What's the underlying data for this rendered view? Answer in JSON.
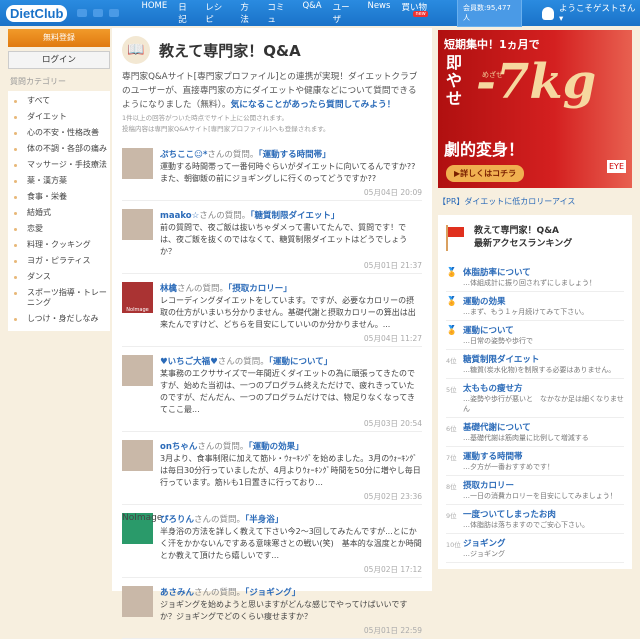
{
  "header": {
    "logo": "DietClub",
    "nav": [
      "HOME",
      "日記",
      "レシピ",
      "方法",
      "コミュ",
      "Q&A",
      "ユーザ",
      "News",
      "買い物"
    ],
    "new_badge": "new",
    "members": "会員数:95,477人",
    "guest": "ようこそゲストさん ▾"
  },
  "left": {
    "register": "無料登録",
    "login": "ログイン",
    "category_label": "質問カテゴリー",
    "categories": [
      "すべて",
      "ダイエット",
      "心の不安・性格改善",
      "体の不調・各部の痛み",
      "マッサージ・手技療法",
      "薬・漢方薬",
      "食事・栄養",
      "結婚式",
      "恋愛",
      "料理・クッキング",
      "ヨガ・ピラティス",
      "ダンス",
      "スポーツ指導・トレーニング",
      "しつけ・身だしなみ"
    ]
  },
  "main": {
    "title": "教えて専門家！Q&A",
    "desc": "専門家Q&Aサイト[専門家プロファイル]との連携が実現！ダイエットクラブのユーザーが、直接専門家の方にダイエットや健康などについて質問できるようになりました（無料）。",
    "desc_link": "気になることがあったら質問してみよう！",
    "note1": "1件以上の回答がついた時点でサイト上に公開されます。",
    "note2": "投稿内容は専門家Q&Aサイト[専門家プロファイル]へも登録されます。",
    "suffix": "さんの質問。",
    "questions": [
      {
        "user": "ぷちここ☺*",
        "topic": "「運動する時間帯」",
        "text": "運動する時間帯って一番何時ぐらいがダイエットに向いてるんですか??また、朝御飯の前にジョギングしに行くのってどうですか??",
        "date": "05月04日 20:09",
        "img": "photo"
      },
      {
        "user": "maako☆",
        "topic": "「糖質制限ダイエット」",
        "text": "前の質問で、夜ご飯は抜いちゃダメって書いてたんで、質問です！では、夜ご飯を抜くのではなくて、糖質制限ダイエットはどうでしょうか？",
        "date": "05月01日 21:37",
        "img": "photo"
      },
      {
        "user": "林檎",
        "topic": "「摂取カロリー」",
        "text": "レコーディングダイエットをしています。ですが、必要なカロリーの摂取の仕方がいまいち分かりません。基礎代謝と摂取カロリーの算出は出来たんですけど、どちらを目安にしていいのか分かりません。...",
        "date": "05月04日 11:27",
        "img": "noimg",
        "noimg": "NoImage"
      },
      {
        "user": "♥いちご大福♥",
        "topic": "「運動について」",
        "text": "某事務のエクササイズで一年間近くダイエットの為に頑張ってきたのですが、始めた当初は、一つのプログラム終えただけで、疲れきっていたのですが、だんだん、一つのプログラムだけでは、物足りなくなってきてここ最...",
        "date": "05月03日 20:54",
        "img": "photo"
      },
      {
        "user": "onちゃん",
        "topic": "「運動の効果」",
        "text": "3月より、食事制限に加えて筋ﾄﾚ・ｳｫｰｷﾝｸﾞを始めました。3月のｳｫｰｷﾝｸﾞは毎日30分行っていましたが、4月よりｳｫｰｷﾝｸﾞ時間を50分に増やし毎日行っています。筋ﾄﾚも1日置きに行っており...",
        "date": "05月02日 23:36",
        "img": "photo"
      },
      {
        "user": "ぴろりん",
        "topic": "「半身浴」",
        "text": "半身浴の方法を詳しく教えて下さい今2〜3回してみたんですが...とにかく汗をかかないんですある意味寒さとの戦い(笑)　基本的な温度とか時間とか教えて頂けたら嬉しいです...",
        "date": "05月02日 17:12",
        "img": "green",
        "noimg": "NoImage"
      },
      {
        "user": "あさみん",
        "topic": "「ジョギング」",
        "text": "ジョギングを始めようと思いますがどんな感じでやってけばいいですか？ジョギングでどのくらい痩せますか？",
        "date": "05月01日 22:59",
        "img": "photo"
      }
    ]
  },
  "right": {
    "ad": {
      "line1": "短期集中！1ヵ月で",
      "line2": "即やせ",
      "big": "-7kg",
      "sub": "めざせ",
      "line3": "劇的変身！",
      "cta": "▶詳しくはコチラ",
      "brand": "EYE"
    },
    "pr": "【PR】ダイエットに低カロリーアイス",
    "ranking_title1": "教えて専門家！Q&A",
    "ranking_title2": "最新アクセスランキング",
    "ranking": [
      {
        "rank": "1位",
        "title": "体脂肪率について",
        "sub": "…体組成計に振り回されずにしましょう！"
      },
      {
        "rank": "2位",
        "title": "運動の効果",
        "sub": "…まず、もう１ヶ月続けてみて下さい。"
      },
      {
        "rank": "3位",
        "title": "運動について",
        "sub": "…日常の姿勢や歩行で"
      },
      {
        "rank": "4位",
        "title": "糖質制限ダイエット",
        "sub": "…糖質(炭水化物)を制限する必要はありません。"
      },
      {
        "rank": "5位",
        "title": "太ももの痩せ方",
        "sub": "…姿勢や歩行が悪いと　なかなか足は細くなりません"
      },
      {
        "rank": "6位",
        "title": "基礎代謝について",
        "sub": "…基礎代謝は筋肉量に比例して増減する"
      },
      {
        "rank": "7位",
        "title": "運動する時間帯",
        "sub": "…夕方が一番おすすめです！"
      },
      {
        "rank": "8位",
        "title": "摂取カロリー",
        "sub": "…一日の消費カロリーを目安にしてみましょう！"
      },
      {
        "rank": "9位",
        "title": "一度ついてしまったお肉",
        "sub": "…体脂肪は落ちますのでご安心下さい。"
      },
      {
        "rank": "10位",
        "title": "ジョギング",
        "sub": "…ジョギング"
      }
    ]
  }
}
